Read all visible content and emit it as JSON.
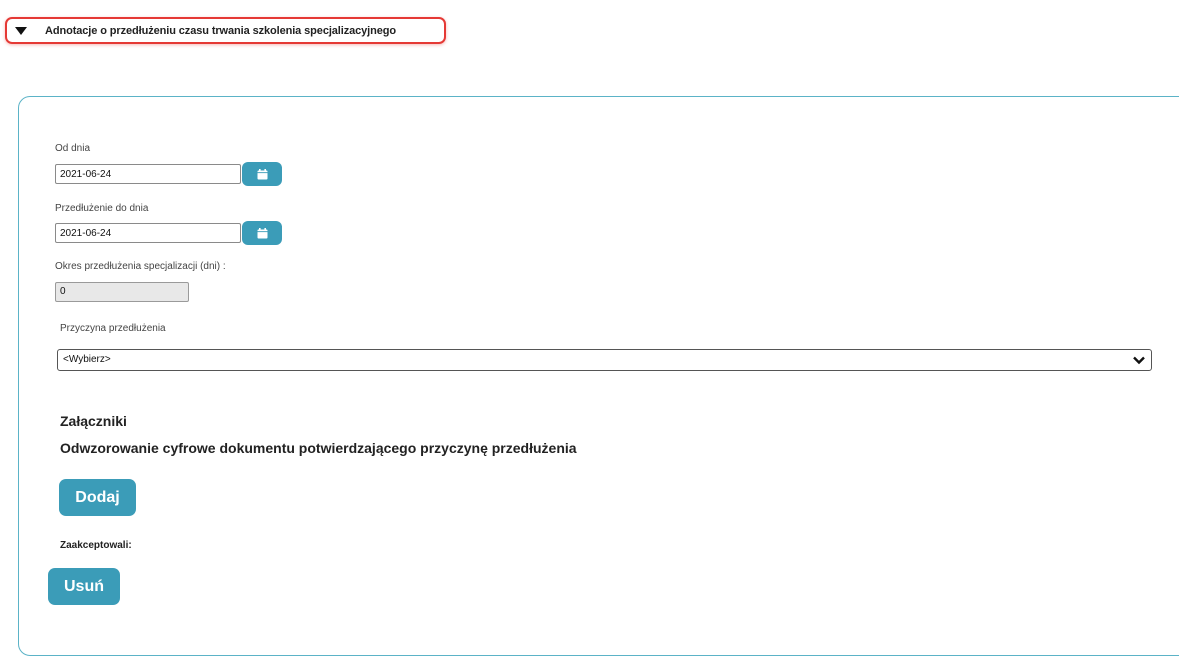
{
  "section": {
    "title": "Adnotacje o przedłużeniu czasu trwania szkolenia specjalizacyjnego",
    "icon": "caret-down-icon"
  },
  "form": {
    "from_date_label": "Od dnia",
    "from_date_value": "2021-06-24",
    "extension_date_label": "Przedłużenie do dnia",
    "extension_date_value": "2021-06-24",
    "period_label": "Okres przedłużenia specjalizacji (dni) :",
    "period_value": "0",
    "reason_label": "Przyczyna przedłużenia",
    "reason_selected": "<Wybierz>",
    "calendar_icon": "calendar-icon"
  },
  "attachments": {
    "heading": "Załączniki",
    "description": "Odwzorowanie cyfrowe dokumentu potwierdzającego przyczynę przedłużenia",
    "add_label": "Dodaj"
  },
  "accepted": {
    "heading": "Zaakceptowali:",
    "remove_label": "Usuń"
  },
  "colors": {
    "accent": "#3b9cb8",
    "panel_border": "#5bb3c7",
    "highlight": "#e53935"
  }
}
